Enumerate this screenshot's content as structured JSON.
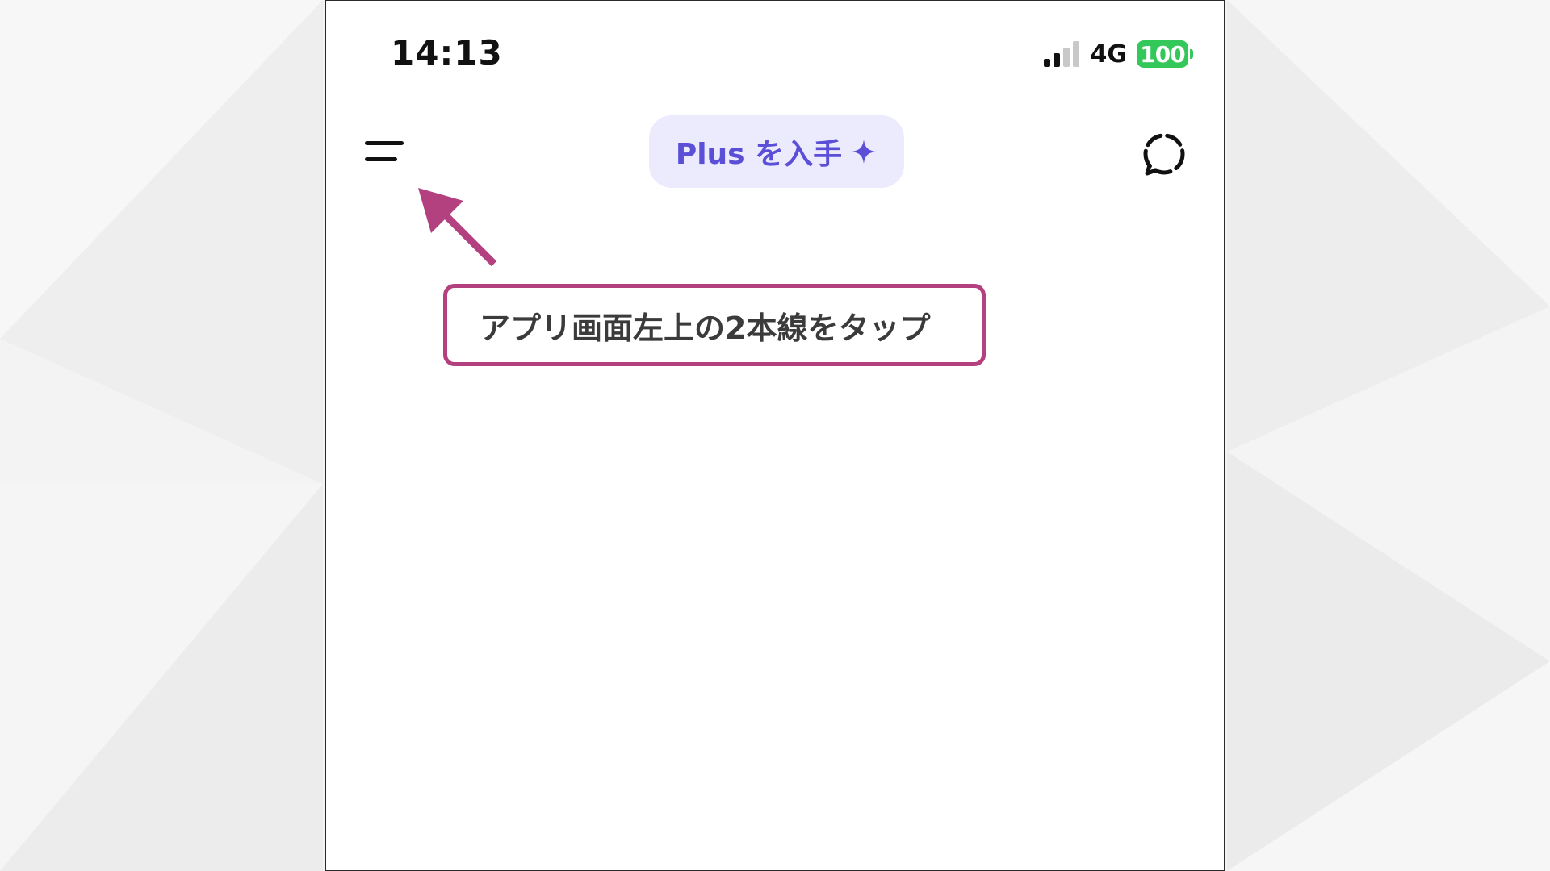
{
  "status_bar": {
    "time": "14:13",
    "network": "4G",
    "battery": "100"
  },
  "header": {
    "menu_icon": "menu-icon",
    "upgrade_button_label": "Plus を入手",
    "upgrade_icon": "sparkle-icon",
    "new_chat_icon": "dashed-circle-icon"
  },
  "annotation": {
    "callout_text": "アプリ画面左上の2本線をタップ",
    "arrow_icon": "arrow-up-left-icon"
  },
  "colors": {
    "accent": "#5b4fd8",
    "accent_bg": "#ecebfd",
    "annotation": "#b3407f",
    "battery": "#34c759"
  }
}
